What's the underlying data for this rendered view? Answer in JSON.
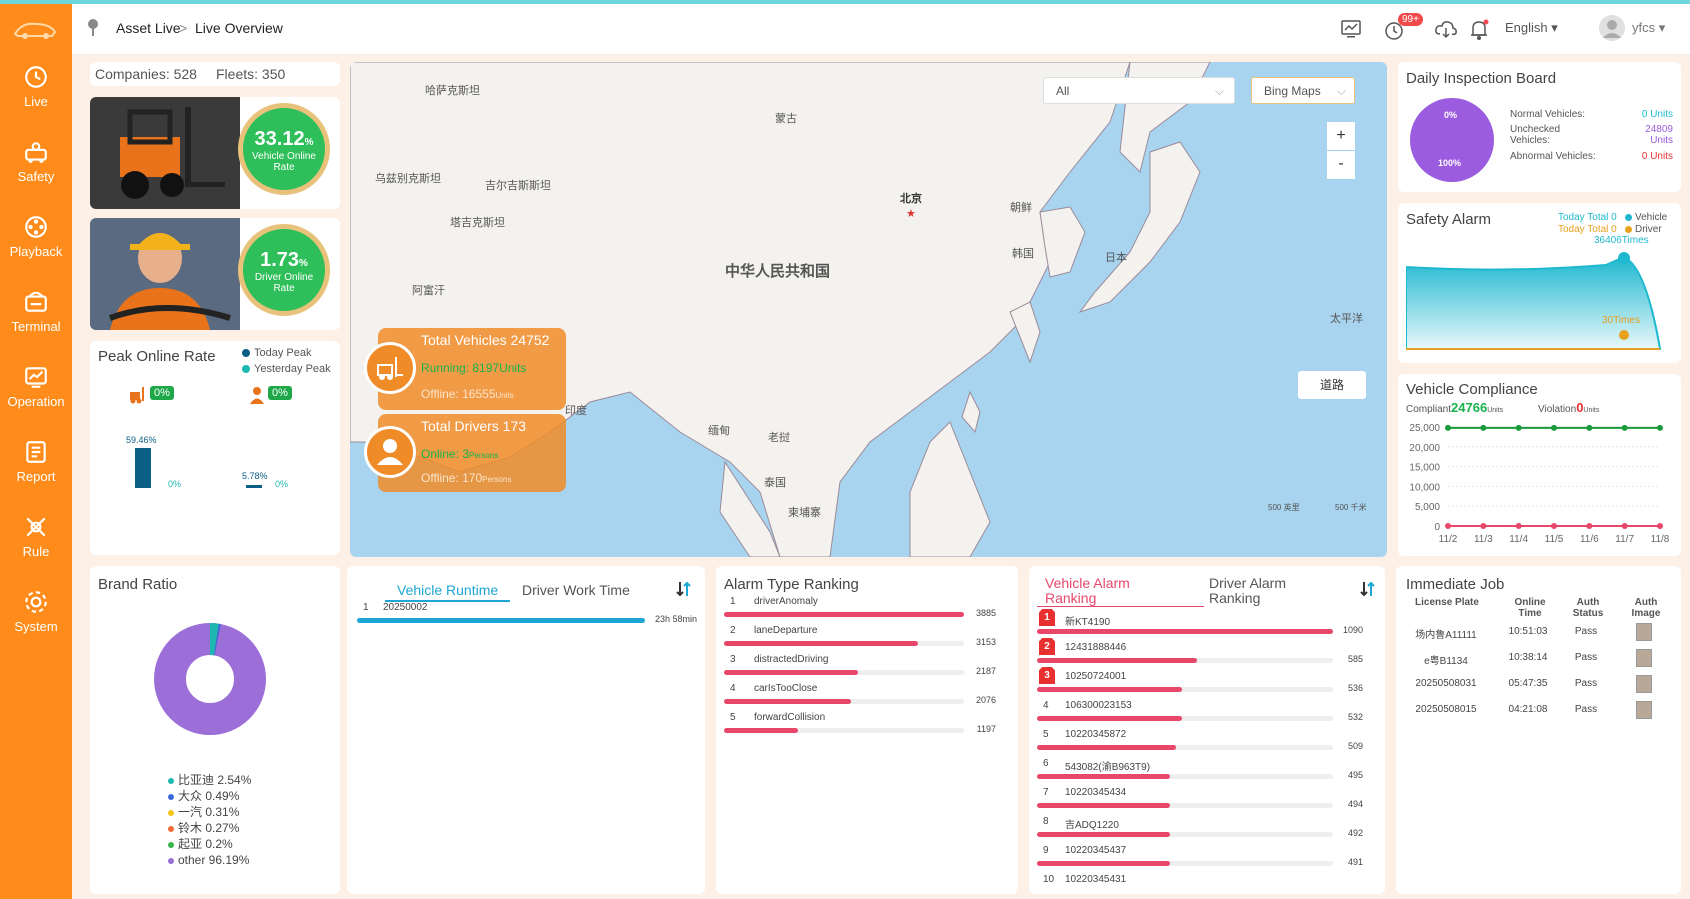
{
  "breadcrumb": {
    "root": "Asset Live",
    "sep": ">",
    "current": "Live Overview"
  },
  "header": {
    "badge": "99+",
    "language": "English",
    "user": "yfcs"
  },
  "nav": [
    {
      "label": "Live",
      "icon": "clock-icon"
    },
    {
      "label": "Safety",
      "icon": "safety-icon"
    },
    {
      "label": "Playback",
      "icon": "playback-icon"
    },
    {
      "label": "Terminal",
      "icon": "terminal-icon"
    },
    {
      "label": "Operation",
      "icon": "operation-icon"
    },
    {
      "label": "Report",
      "icon": "report-icon"
    },
    {
      "label": "Rule",
      "icon": "rule-icon"
    },
    {
      "label": "System",
      "icon": "system-icon"
    }
  ],
  "stats": {
    "companies": "Companies: 528",
    "fleets": "Fleets: 350"
  },
  "vehicle_online": {
    "value": "33.12",
    "unit": "%",
    "label": "Vehicle Online Rate"
  },
  "driver_online": {
    "value": "1.73",
    "unit": "%",
    "label": "Driver Online Rate"
  },
  "peak": {
    "title": "Peak Online Rate",
    "legend_today": "Today Peak",
    "legend_yesterday": "Yesterday Peak",
    "vehicle_change": "0%",
    "driver_change": "0%",
    "v_today": "59.46%",
    "v_yest": "0%",
    "d_today": "5.78%",
    "d_yest": "0%",
    "colors": {
      "today": "#0b5e85",
      "yesterday": "#1eb8b0"
    }
  },
  "map": {
    "filter": "All",
    "provider": "Bing Maps",
    "zoom_in": "+",
    "zoom_out": "-",
    "road_btn": "道路",
    "labels": {
      "kaz": "哈萨克斯坦",
      "mon": "蒙古",
      "uzb": "乌兹别克斯坦",
      "kgz": "吉尔吉斯斯坦",
      "tjk": "塔吉克斯坦",
      "chn": "中华人民共和国",
      "bj": "北京",
      "prk": "朝鲜",
      "kor": "韩国",
      "jpn": "日本",
      "afg": "阿富汗",
      "ind": "印度",
      "mmr": "缅甸",
      "lao": "老挝",
      "tha": "泰国",
      "khm": "柬埔寨",
      "pac": "太平洋",
      "scale1": "500 英里",
      "scale2": "500 千米"
    }
  },
  "vehicles_card": {
    "title": "Total Vehicles 24752",
    "running": "Running: 8197",
    "running_unit": "Units",
    "offline": "Offline: 16555",
    "offline_unit": "Units"
  },
  "drivers_card": {
    "title": "Total Drivers 173",
    "online": "Online: 3",
    "online_unit": "Persons",
    "offline": "Offline: 170",
    "offline_unit": "Persons"
  },
  "inspection": {
    "title": "Daily Inspection Board",
    "pie_top": "0%",
    "pie_bottom": "100%",
    "normal_label": "Normal Vehicles:",
    "normal_val": "0 Units",
    "unchecked_label": "Unchecked Vehicles:",
    "unchecked_val": "24809 Units",
    "abnormal_label": "Abnormal Vehicles:",
    "abnormal_val": "0 Units"
  },
  "safety": {
    "title": "Safety Alarm",
    "today_vehicle": "Today Total 0",
    "vehicle": "Vehicle",
    "today_driver": "Today Total 0",
    "driver": "Driver",
    "peak_v": "36406Times",
    "peak_d": "30Times"
  },
  "compliance": {
    "title": "Vehicle Compliance",
    "compliant_label": "Compliant",
    "compliant_val": "24766",
    "units": "Units",
    "violation_label": "Violation",
    "violation_val": "0",
    "units2": "Units"
  },
  "chart_data": {
    "type": "line",
    "categories": [
      "11/2",
      "11/3",
      "11/4",
      "11/5",
      "11/6",
      "11/7",
      "11/8"
    ],
    "series": [
      {
        "name": "Compliant",
        "values": [
          24766,
          24766,
          24766,
          24766,
          24766,
          24766,
          24766
        ]
      },
      {
        "name": "Violation",
        "values": [
          0,
          0,
          0,
          0,
          0,
          0,
          0
        ]
      }
    ],
    "yticks": [
      "25,000",
      "20,000",
      "15,000",
      "10,000",
      "5,000",
      "0"
    ],
    "ylim": [
      0,
      25000
    ]
  },
  "brand": {
    "title": "Brand Ratio",
    "items": [
      {
        "name": "比亚迪 2.54%",
        "color": "#1eb8b0"
      },
      {
        "name": "大众 0.49%",
        "color": "#3a6ad8"
      },
      {
        "name": "一汽 0.31%",
        "color": "#f5c518"
      },
      {
        "name": "铃木 0.27%",
        "color": "#f06a3a"
      },
      {
        "name": "起亚 0.2%",
        "color": "#3ab54a"
      },
      {
        "name": "other 96.19%",
        "color": "#9b6ed8"
      }
    ]
  },
  "runtime": {
    "tab1": "Vehicle Runtime",
    "tab2": "Driver Work Time",
    "rows": [
      {
        "idx": "1",
        "name": "20250002",
        "val": "23h 58min",
        "fill": 1.0
      }
    ]
  },
  "alarm_type": {
    "title": "Alarm Type Ranking",
    "rows": [
      {
        "idx": "1",
        "name": "driverAnomaly",
        "val": "3885",
        "fill": 1.0
      },
      {
        "idx": "2",
        "name": "laneDeparture",
        "val": "3153",
        "fill": 0.81
      },
      {
        "idx": "3",
        "name": "distractedDriving",
        "val": "2187",
        "fill": 0.56
      },
      {
        "idx": "4",
        "name": "carIsTooClose",
        "val": "2076",
        "fill": 0.53
      },
      {
        "idx": "5",
        "name": "forwardCollision",
        "val": "1197",
        "fill": 0.31
      }
    ]
  },
  "vehicle_alarm": {
    "tab1": "Vehicle Alarm Ranking",
    "tab2": "Driver Alarm Ranking",
    "rows": [
      {
        "idx": "1",
        "name": "新KT4190",
        "val": "1090",
        "fill": 1.0
      },
      {
        "idx": "2",
        "name": "12431888446",
        "val": "585",
        "fill": 0.54
      },
      {
        "idx": "3",
        "name": "10250724001",
        "val": "536",
        "fill": 0.49
      },
      {
        "idx": "4",
        "name": "106300023153",
        "val": "532",
        "fill": 0.49
      },
      {
        "idx": "5",
        "name": "10220345872",
        "val": "509",
        "fill": 0.47
      },
      {
        "idx": "6",
        "name": "543082(渝B963T9)",
        "val": "495",
        "fill": 0.45
      },
      {
        "idx": "7",
        "name": "10220345434",
        "val": "494",
        "fill": 0.45
      },
      {
        "idx": "8",
        "name": "吉ADQ1220",
        "val": "492",
        "fill": 0.45
      },
      {
        "idx": "9",
        "name": "10220345437",
        "val": "491",
        "fill": 0.45
      },
      {
        "idx": "10",
        "name": "10220345431",
        "val": "",
        "fill": 0
      }
    ]
  },
  "job": {
    "title": "Immediate Job",
    "headers": [
      "License Plate",
      "Online Time",
      "Auth Status",
      "Auth Image"
    ],
    "rows": [
      {
        "plate": "场内鲁A11111",
        "time": "10:51:03",
        "status": "Pass"
      },
      {
        "plate": "e粤B1134",
        "time": "10:38:14",
        "status": "Pass"
      },
      {
        "plate": "20250508031",
        "time": "05:47:35",
        "status": "Pass"
      },
      {
        "plate": "20250508015",
        "time": "04:21:08",
        "status": "Pass"
      }
    ]
  }
}
